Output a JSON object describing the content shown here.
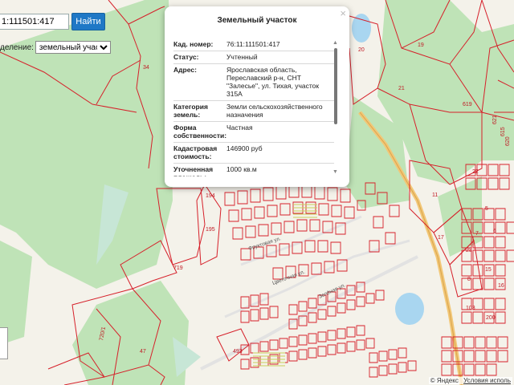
{
  "search": {
    "value": "1:111501:417",
    "button_label": "Найти"
  },
  "type_filter": {
    "label": "деление:",
    "selected": "земельный участок"
  },
  "popup": {
    "title": "Земельный участок",
    "close_glyph": "×",
    "rows": [
      {
        "label": "Кад. номер:",
        "value": "76:11:111501:417"
      },
      {
        "label": "Статус:",
        "value": "Учтенный"
      },
      {
        "label": "Адрес:",
        "value": "Ярославская область, Переславский р-н, СНТ \"Залесье\", ул. Тихая, участок 315А"
      },
      {
        "label": "Категория земель:",
        "value": "Земли сельскохозяйственного назначения"
      },
      {
        "label": "Форма собственности:",
        "value": "Частная"
      },
      {
        "label": "Кадастровая стоимость:",
        "value": "146900 руб"
      },
      {
        "label": "Уточненная площадь:",
        "value": "1000 кв.м"
      }
    ]
  },
  "map": {
    "parcel_numbers": [
      "34",
      "20",
      "19",
      "21",
      "619",
      "194",
      "195",
      "719",
      "47",
      "720/1",
      "493",
      "11",
      "17",
      "103",
      "200",
      "621",
      "615",
      "620",
      "7",
      "23",
      "5",
      "6",
      "8",
      "15",
      "16",
      "22"
    ],
    "street_labels": [
      "Фруктовая ул.",
      "Зелёная ул.",
      "Цветочная ул."
    ],
    "attribution": {
      "provider": "© Яндекс",
      "terms": "Условия исполь"
    },
    "colors": {
      "parcel": "#d6202a",
      "forest": "#bfe3b7",
      "water": "#a9d6f0",
      "road": "#f2c777"
    }
  }
}
